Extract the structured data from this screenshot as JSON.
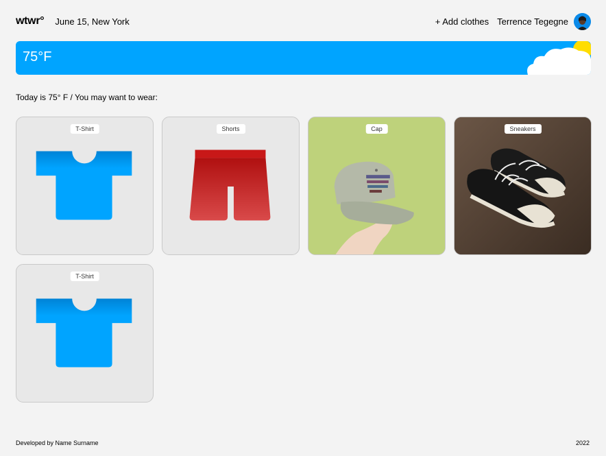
{
  "header": {
    "logo": "wtwr°",
    "date_location": "June 15, New York",
    "add_clothes_label": "+ Add clothes",
    "user_name": "Terrence Tegegne"
  },
  "weather": {
    "temperature": "75°F"
  },
  "intro": "Today is 75° F / You may want to wear:",
  "cards": [
    {
      "label": "T-Shirt",
      "icon": "tshirt-icon",
      "color": "#00a4ff"
    },
    {
      "label": "Shorts",
      "icon": "shorts-icon",
      "color": "#c41e1e"
    },
    {
      "label": "Cap",
      "icon": "cap-photo"
    },
    {
      "label": "Sneakers",
      "icon": "sneakers-photo"
    },
    {
      "label": "T-Shirt",
      "icon": "tshirt-icon",
      "color": "#00a4ff"
    }
  ],
  "footer": {
    "credit": "Developed by Name Surname",
    "year": "2022"
  }
}
